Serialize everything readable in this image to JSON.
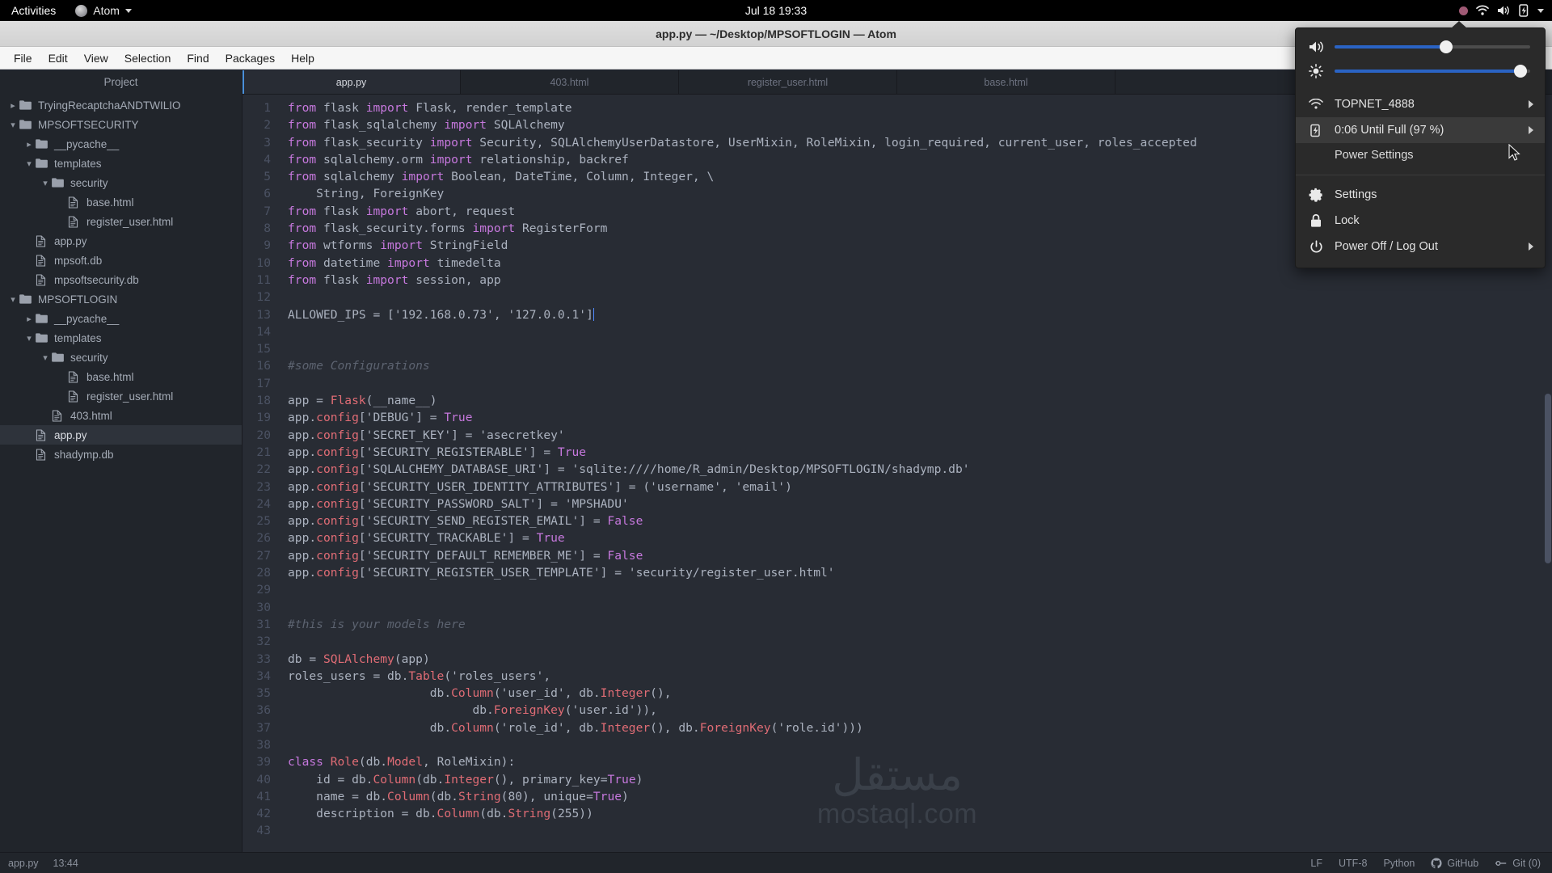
{
  "gnome_topbar": {
    "activities": "Activities",
    "app_name": "Atom",
    "clock": "Jul 18  19:33",
    "icons": [
      "record-dot-icon",
      "wifi-icon",
      "volume-icon",
      "battery-charging-icon",
      "chevron-down-icon"
    ]
  },
  "window": {
    "title": "app.py — ~/Desktop/MPSOFTLOGIN — Atom",
    "menus": [
      "File",
      "Edit",
      "View",
      "Selection",
      "Find",
      "Packages",
      "Help"
    ]
  },
  "tree_view": {
    "header": "Project",
    "items": [
      {
        "label": "TryingRecaptchaANDTWILIO",
        "type": "folder",
        "depth": 0,
        "expanded": false,
        "selected": false
      },
      {
        "label": "MPSOFTSECURITY",
        "type": "folder",
        "depth": 0,
        "expanded": true,
        "selected": false
      },
      {
        "label": "__pycache__",
        "type": "folder",
        "depth": 1,
        "expanded": false,
        "selected": false
      },
      {
        "label": "templates",
        "type": "folder",
        "depth": 1,
        "expanded": true,
        "selected": false
      },
      {
        "label": "security",
        "type": "folder",
        "depth": 2,
        "expanded": true,
        "selected": false
      },
      {
        "label": "base.html",
        "type": "file",
        "depth": 3,
        "expanded": null,
        "selected": false
      },
      {
        "label": "register_user.html",
        "type": "file",
        "depth": 3,
        "expanded": null,
        "selected": false
      },
      {
        "label": "app.py",
        "type": "file",
        "depth": 1,
        "expanded": null,
        "selected": false
      },
      {
        "label": "mpsoft.db",
        "type": "file",
        "depth": 1,
        "expanded": null,
        "selected": false
      },
      {
        "label": "mpsoftsecurity.db",
        "type": "file",
        "depth": 1,
        "expanded": null,
        "selected": false
      },
      {
        "label": "MPSOFTLOGIN",
        "type": "folder",
        "depth": 0,
        "expanded": true,
        "selected": false
      },
      {
        "label": "__pycache__",
        "type": "folder",
        "depth": 1,
        "expanded": false,
        "selected": false
      },
      {
        "label": "templates",
        "type": "folder",
        "depth": 1,
        "expanded": true,
        "selected": false
      },
      {
        "label": "security",
        "type": "folder",
        "depth": 2,
        "expanded": true,
        "selected": false
      },
      {
        "label": "base.html",
        "type": "file",
        "depth": 3,
        "expanded": null,
        "selected": false
      },
      {
        "label": "register_user.html",
        "type": "file",
        "depth": 3,
        "expanded": null,
        "selected": false
      },
      {
        "label": "403.html",
        "type": "file",
        "depth": 2,
        "expanded": null,
        "selected": false
      },
      {
        "label": "app.py",
        "type": "file",
        "depth": 1,
        "expanded": null,
        "selected": true
      },
      {
        "label": "shadymp.db",
        "type": "file",
        "depth": 1,
        "expanded": null,
        "selected": false
      }
    ]
  },
  "tabs": [
    {
      "label": "app.py",
      "active": true
    },
    {
      "label": "403.html",
      "active": false
    },
    {
      "label": "register_user.html",
      "active": false
    },
    {
      "label": "base.html",
      "active": false
    }
  ],
  "editor": {
    "first_line_number": 1,
    "lines": [
      {
        "n": 1,
        "text": "from flask import Flask, render_template"
      },
      {
        "n": 2,
        "text": "from flask_sqlalchemy import SQLAlchemy"
      },
      {
        "n": 3,
        "text": "from flask_security import Security, SQLAlchemyUserDatastore, UserMixin, RoleMixin, login_required, current_user, roles_accepted"
      },
      {
        "n": 4,
        "text": "from sqlalchemy.orm import relationship, backref"
      },
      {
        "n": 5,
        "text": "from sqlalchemy import Boolean, DateTime, Column, Integer, \\"
      },
      {
        "n": 6,
        "text": "    String, ForeignKey"
      },
      {
        "n": 7,
        "text": "from flask import abort, request"
      },
      {
        "n": 8,
        "text": "from flask_security.forms import RegisterForm"
      },
      {
        "n": 9,
        "text": "from wtforms import StringField"
      },
      {
        "n": 10,
        "text": "from datetime import timedelta"
      },
      {
        "n": 11,
        "text": "from flask import session, app"
      },
      {
        "n": 12,
        "text": ""
      },
      {
        "n": 13,
        "text": "ALLOWED_IPS = ['192.168.0.73', '127.0.0.1']"
      },
      {
        "n": 14,
        "text": ""
      },
      {
        "n": 15,
        "text": ""
      },
      {
        "n": 16,
        "text": "#some Configurations"
      },
      {
        "n": 17,
        "text": ""
      },
      {
        "n": 18,
        "text": "app = Flask(__name__)"
      },
      {
        "n": 19,
        "text": "app.config['DEBUG'] = True"
      },
      {
        "n": 20,
        "text": "app.config['SECRET_KEY'] = 'asecretkey'"
      },
      {
        "n": 21,
        "text": "app.config['SECURITY_REGISTERABLE'] = True"
      },
      {
        "n": 22,
        "text": "app.config['SQLALCHEMY_DATABASE_URI'] = 'sqlite:////home/R_admin/Desktop/MPSOFTLOGIN/shadymp.db'"
      },
      {
        "n": 23,
        "text": "app.config['SECURITY_USER_IDENTITY_ATTRIBUTES'] = ('username', 'email')"
      },
      {
        "n": 24,
        "text": "app.config['SECURITY_PASSWORD_SALT'] = 'MPSHADU'"
      },
      {
        "n": 25,
        "text": "app.config['SECURITY_SEND_REGISTER_EMAIL'] = False"
      },
      {
        "n": 26,
        "text": "app.config['SECURITY_TRACKABLE'] = True"
      },
      {
        "n": 27,
        "text": "app.config['SECURITY_DEFAULT_REMEMBER_ME'] = False"
      },
      {
        "n": 28,
        "text": "app.config['SECURITY_REGISTER_USER_TEMPLATE'] = 'security/register_user.html'"
      },
      {
        "n": 29,
        "text": ""
      },
      {
        "n": 30,
        "text": ""
      },
      {
        "n": 31,
        "text": "#this is your models here"
      },
      {
        "n": 32,
        "text": ""
      },
      {
        "n": 33,
        "text": "db = SQLAlchemy(app)"
      },
      {
        "n": 34,
        "text": "roles_users = db.Table('roles_users',"
      },
      {
        "n": 35,
        "text": "                    db.Column('user_id', db.Integer(),"
      },
      {
        "n": 36,
        "text": "                          db.ForeignKey('user.id')),"
      },
      {
        "n": 37,
        "text": "                    db.Column('role_id', db.Integer(), db.ForeignKey('role.id')))"
      },
      {
        "n": 38,
        "text": ""
      },
      {
        "n": 39,
        "text": "class Role(db.Model, RoleMixin):"
      },
      {
        "n": 40,
        "text": "    id = db.Column(db.Integer(), primary_key=True)"
      },
      {
        "n": 41,
        "text": "    name = db.Column(db.String(80), unique=True)"
      },
      {
        "n": 42,
        "text": "    description = db.Column(db.String(255))"
      },
      {
        "n": 43,
        "text": ""
      }
    ]
  },
  "watermark": {
    "arabic": "مستقل",
    "latin": "mostaql.com"
  },
  "status_bar": {
    "left": [
      {
        "label": "app.py"
      },
      {
        "label": "13:44"
      }
    ],
    "right": [
      {
        "label": "LF",
        "icon": null
      },
      {
        "label": "UTF-8",
        "icon": null
      },
      {
        "label": "Python",
        "icon": null
      },
      {
        "label": "GitHub",
        "icon": "github-icon"
      },
      {
        "label": "Git (0)",
        "icon": "git-branch-icon"
      }
    ]
  },
  "system_menu": {
    "volume": {
      "icon": "volume-icon",
      "value": 57
    },
    "brightness": {
      "icon": "brightness-icon",
      "value": 95
    },
    "wifi": {
      "icon": "wifi-icon",
      "label": "TOPNET_4888",
      "has_submenu": true
    },
    "battery": {
      "icon": "battery-charging-icon",
      "label": "0:06 Until Full (97 %)",
      "has_submenu": true,
      "highlighted": true
    },
    "power_settings": {
      "label": "Power Settings"
    },
    "settings": {
      "icon": "gear-icon",
      "label": "Settings"
    },
    "lock": {
      "icon": "lock-icon",
      "label": "Lock"
    },
    "power_off": {
      "icon": "power-icon",
      "label": "Power Off / Log Out",
      "has_submenu": true
    }
  },
  "colors": {
    "editor_bg": "#282c34",
    "sidebar_bg": "#21252b",
    "accent_blue": "#2a63c4",
    "tab_accent": "#4a90d9",
    "keyword": "#c678dd",
    "function": "#e06c75",
    "comment": "#5c6370"
  }
}
